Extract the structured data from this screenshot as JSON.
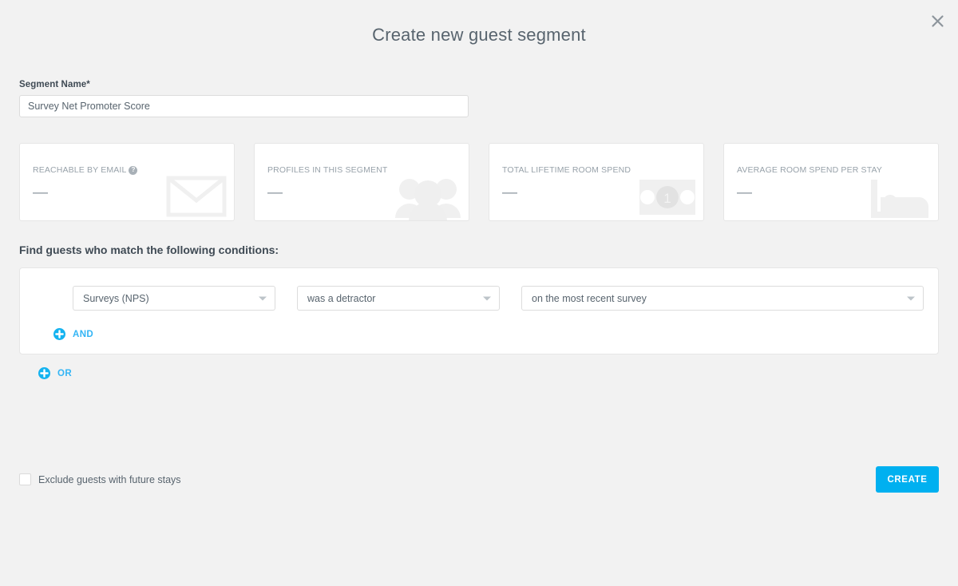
{
  "dialog": {
    "title": "Create new guest segment",
    "close_icon": "close-icon"
  },
  "segment_name": {
    "label": "Segment Name*",
    "value": "Survey Net Promoter Score",
    "placeholder": "Segment Name"
  },
  "stats": {
    "cards": [
      {
        "label": "REACHABLE BY EMAIL",
        "value": "—",
        "help": "?",
        "has_help": true,
        "icon": "envelope-icon"
      },
      {
        "label": "PROFILES IN THIS SEGMENT",
        "value": "—",
        "has_help": false,
        "icon": "people-group-icon"
      },
      {
        "label": "TOTAL LIFETIME ROOM SPEND",
        "value": "—",
        "has_help": false,
        "icon": "banknote-icon"
      },
      {
        "label": "AVERAGE ROOM SPEND PER STAY",
        "value": "—",
        "has_help": false,
        "icon": "bed-icon"
      }
    ]
  },
  "conditions": {
    "heading": "Find guests who match the following conditions:",
    "row": {
      "field": "Surveys (NPS)",
      "operator": "was a detractor",
      "scope": "on the most recent survey"
    },
    "and_label": "AND",
    "or_label": "OR"
  },
  "footer": {
    "exclude_label": "Exclude guests with future stays",
    "exclude_checked": false,
    "create_label": "CREATE"
  },
  "colors": {
    "accent": "#00b0f0",
    "link": "#33b5f5",
    "background": "#f2f2f2",
    "surface": "#ffffff",
    "text": "#58646e",
    "muted": "#98a2aa"
  }
}
